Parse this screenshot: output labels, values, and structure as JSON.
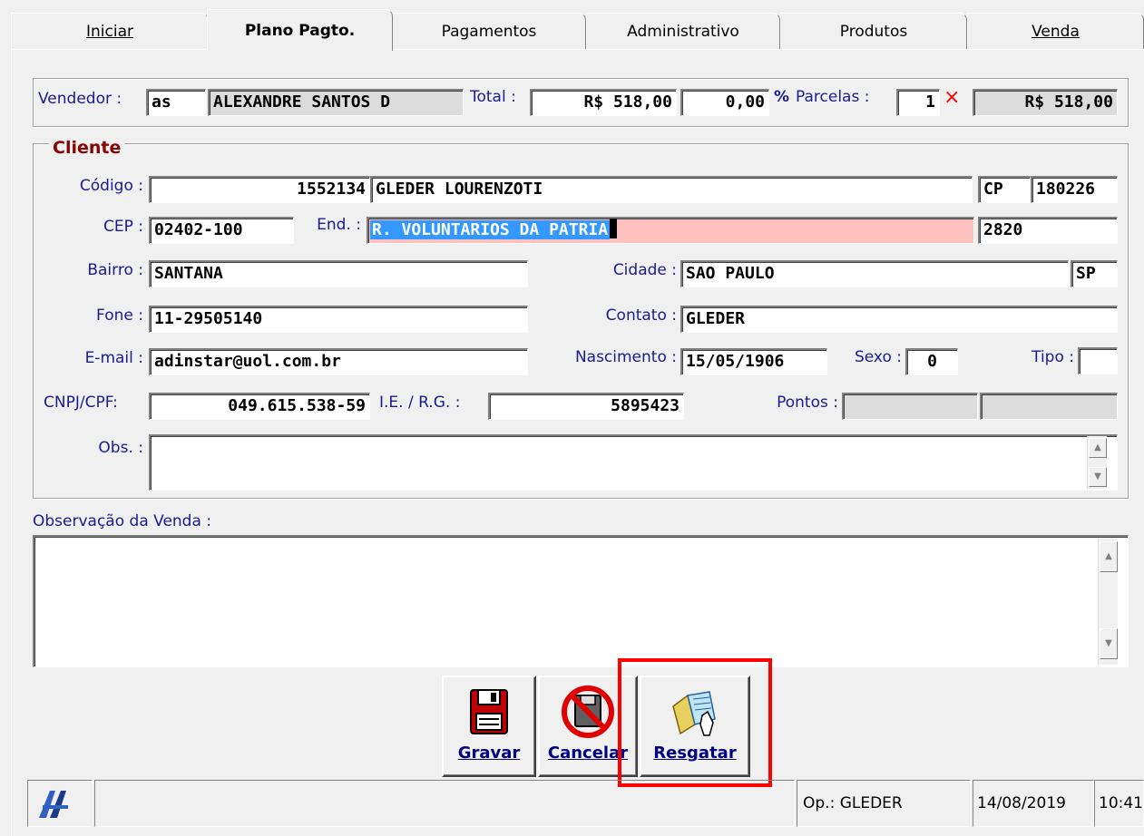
{
  "tabs": [
    {
      "label": "Iniciar"
    },
    {
      "label": "Plano Pagto."
    },
    {
      "label": "Pagamentos"
    },
    {
      "label": "Administrativo"
    },
    {
      "label": "Produtos"
    },
    {
      "label": "Venda"
    }
  ],
  "header": {
    "vendedor_label": "Vendedor :",
    "vendedor_code": "as",
    "vendedor_name": "ALEXANDRE SANTOS D",
    "total_label": "Total :",
    "total_value": "R$ 518,00",
    "discount_value": "0,00",
    "percent_symbol": "%",
    "parcelas_label": "Parcelas :",
    "parcelas_value": "1",
    "times_symbol": "×",
    "parcela_amount": "R$ 518,00"
  },
  "cliente": {
    "title": "Cliente",
    "codigo_label": "Código :",
    "codigo_value": "1552134",
    "nome_value": "GLEDER  LOURENZOTI",
    "cp_label": "CP",
    "cp_value": "180226",
    "cep_label": "CEP :",
    "cep_value": "02402-100",
    "end_label": "End. :",
    "end_value": "R. VOLUNTARIOS DA PATRIA",
    "numero_value": "2820",
    "bairro_label": "Bairro :",
    "bairro_value": "SANTANA",
    "cidade_label": "Cidade :",
    "cidade_value": "SAO PAULO",
    "uf_value": "SP",
    "fone_label": "Fone :",
    "fone_value": "11-29505140",
    "contato_label": "Contato :",
    "contato_value": "GLEDER",
    "email_label": "E-mail :",
    "email_value": "adinstar@uol.com.br",
    "nascimento_label": "Nascimento :",
    "nascimento_value": "15/05/1906",
    "sexo_label": "Sexo :",
    "sexo_value": "0",
    "tipo_label": "Tipo :",
    "tipo_value": "",
    "cnpj_label": "CNPJ/CPF:",
    "cnpj_value": "049.615.538-59",
    "ie_label": "I.E. / R.G. :",
    "ie_value": "5895423",
    "pontos_label": "Pontos :",
    "obs_label": "Obs. :",
    "obs_value": ""
  },
  "venda": {
    "obs_label": "Observação da Venda :",
    "obs_value": ""
  },
  "buttons": {
    "gravar": "Gravar",
    "cancelar": "Cancelar",
    "resgatar": "Resgatar"
  },
  "statusbar": {
    "operator": "Op.: GLEDER",
    "date": "14/08/2019",
    "time": "10:41"
  },
  "colors": {
    "highlight": "#ff0000",
    "selection": "#3399ff",
    "address_field": "#ffc0c0",
    "label_blue": "#1b1b8f"
  }
}
